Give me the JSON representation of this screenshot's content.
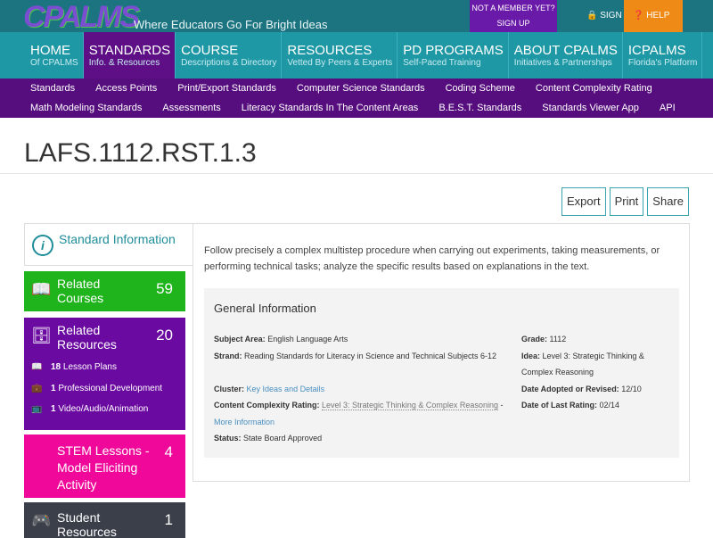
{
  "header": {
    "logo": "CPALMS",
    "tagline": "Where Educators Go For Bright Ideas",
    "signup_top": "NOT A MEMBER YET?",
    "signup_bottom": "SIGN UP",
    "signin": "SIGN IN",
    "help": "HELP"
  },
  "nav": [
    {
      "t": "HOME",
      "s": "Of CPALMS"
    },
    {
      "t": "STANDARDS",
      "s": "Info. & Resources"
    },
    {
      "t": "COURSE",
      "s": "Descriptions & Directory"
    },
    {
      "t": "RESOURCES",
      "s": "Vetted By Peers & Experts"
    },
    {
      "t": "PD PROGRAMS",
      "s": "Self-Paced Training"
    },
    {
      "t": "ABOUT CPALMS",
      "s": "Initiatives & Partnerships"
    },
    {
      "t": "ICPALMS",
      "s": "Florida's Platform"
    }
  ],
  "subnav": {
    "row1": [
      "Standards",
      "Access Points",
      "Print/Export Standards",
      "Computer Science Standards",
      "Coding Scheme",
      "Content Complexity Rating"
    ],
    "row2": [
      "Math Modeling Standards",
      "Assessments",
      "Literacy Standards In The Content Areas",
      "B.E.S.T. Standards",
      "Standards Viewer App",
      "API"
    ]
  },
  "title": "LAFS.1112.RST.1.3",
  "actions": {
    "export": "Export",
    "print": "Print",
    "share": "Share"
  },
  "sidebar": {
    "standard_info": "Standard Information",
    "courses": {
      "label": "Related Courses",
      "count": "59",
      "color": "#20b41c"
    },
    "resources": {
      "label": "Related Resources",
      "count": "20",
      "color": "#6a0aa0",
      "items": [
        {
          "n": "18",
          "l": "Lesson Plans"
        },
        {
          "n": "1",
          "l": "Professional Development"
        },
        {
          "n": "1",
          "l": "Video/Audio/Animation"
        }
      ]
    },
    "stem": {
      "label": "STEM Lessons - Model Eliciting Activity",
      "count": "4",
      "color": "#f0089a"
    },
    "student": {
      "label": "Student Resources",
      "count": "1",
      "color": "#3b3f4a"
    }
  },
  "description": "Follow precisely a complex multistep procedure when carrying out experiments, taking measurements, or performing technical tasks; analyze the specific results based on explanations in the text.",
  "general": {
    "heading": "General Information",
    "subject_k": "Subject Area:",
    "subject_v": "English Language Arts",
    "strand_k": "Strand:",
    "strand_v": "Reading Standards for Literacy in Science and Technical Subjects 6-12",
    "cluster_k": "Cluster:",
    "cluster_v": "Key Ideas and Details",
    "ccr_k": "Content Complexity Rating:",
    "ccr_v": "Level 3: Strategic Thinking & Complex Reasoning",
    "ccr_sep": " -",
    "more": "More Information",
    "status_k": "Status:",
    "status_v": "State Board Approved",
    "grade_k": "Grade:",
    "grade_v": "1112",
    "idea_k": "Idea:",
    "idea_v": "Level 3: Strategic Thinking & Complex Reasoning",
    "adopted_k": "Date Adopted or Revised:",
    "adopted_v": "12/10",
    "rating_k": "Date of Last Rating:",
    "rating_v": "02/14"
  }
}
